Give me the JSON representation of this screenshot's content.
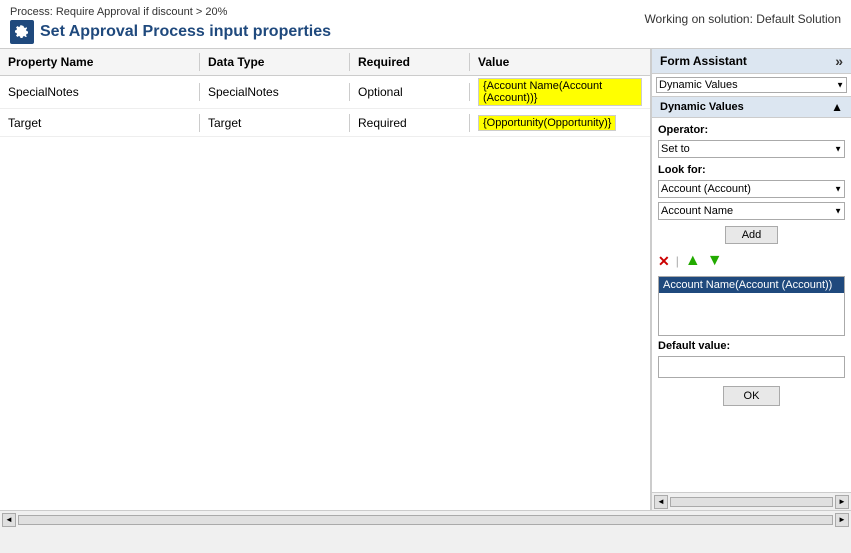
{
  "topbar": {
    "process_subtitle": "Process: Require Approval if discount > 20%",
    "page_title": "Set Approval Process input properties",
    "working_on": "Working on solution: Default Solution"
  },
  "table": {
    "headers": {
      "property_name": "Property Name",
      "data_type": "Data Type",
      "required": "Required",
      "value": "Value"
    },
    "rows": [
      {
        "property": "SpecialNotes",
        "data_type": "SpecialNotes",
        "required": "Optional",
        "value": "{Account Name(Account (Account))}"
      },
      {
        "property": "Target",
        "data_type": "Target",
        "required": "Required",
        "value": "{Opportunity(Opportunity)}"
      }
    ]
  },
  "form_assistant": {
    "header_label": "Form Assistant",
    "chevron_label": "»",
    "dynamic_values_select": "Dynamic Values",
    "dynamic_values_section_label": "Dynamic Values",
    "operator_label": "Operator:",
    "operator_value": "Set to",
    "look_for_label": "Look for:",
    "look_for_value": "Account (Account)",
    "field_value": "Account Name",
    "add_button": "Add",
    "selected_item": "Account Name(Account (Account))",
    "default_value_label": "Default value:",
    "default_value_placeholder": "",
    "ok_button": "OK"
  },
  "icons": {
    "x_icon": "✕",
    "up_icon": "▲",
    "down_icon": "▼",
    "gear_unicode": "⚙",
    "chevron_right": "»",
    "scroll_left": "◄",
    "scroll_right": "►"
  }
}
